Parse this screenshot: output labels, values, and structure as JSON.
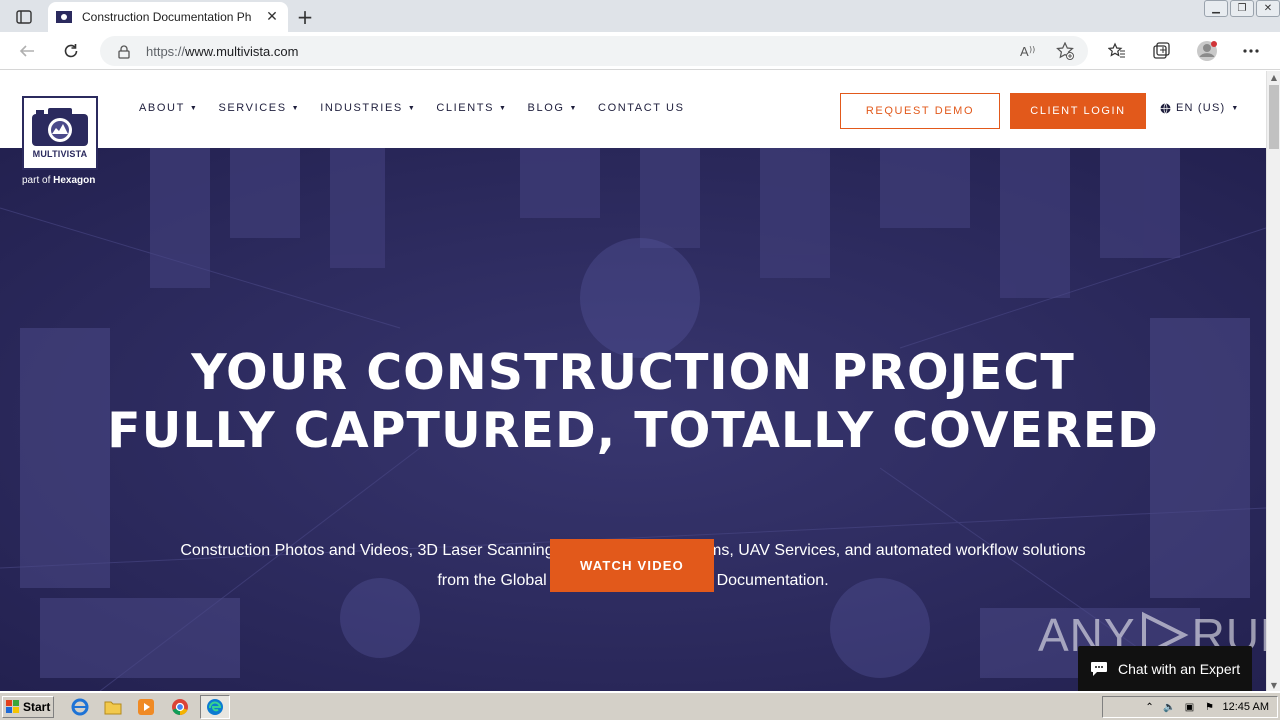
{
  "browser": {
    "tab_title": "Construction Documentation Ph",
    "url_prefix": "https://",
    "url_host": "www.multivista.com"
  },
  "site": {
    "logo_text": "MULTIVISTA",
    "logo_sub_prefix": "part of",
    "logo_sub_brand": "Hexagon",
    "nav": [
      {
        "label": "ABOUT"
      },
      {
        "label": "SERVICES"
      },
      {
        "label": "INDUSTRIES"
      },
      {
        "label": "CLIENTS"
      },
      {
        "label": "BLOG"
      },
      {
        "label": "CONTACT US"
      }
    ],
    "request_demo": "REQUEST DEMO",
    "client_login": "CLIENT LOGIN",
    "language": "EN (US)"
  },
  "hero": {
    "title_line1": "YOUR CONSTRUCTION PROJECT",
    "title_line2": "FULLY CAPTURED, TOTALLY COVERED",
    "subtitle_line1": "Construction Photos and Videos, 3D Laser Scanning, Scan to BIM, Webcams, UAV Services, and automated workflow solutions",
    "subtitle_line2": "from the Global Leader in Construction Documentation.",
    "cta": "WATCH VIDEO"
  },
  "chat": {
    "label": "Chat with an Expert"
  },
  "watermark": {
    "left": "ANY",
    "right": "RUN"
  },
  "taskbar": {
    "start": "Start",
    "clock": "12:45 AM"
  },
  "colors": {
    "brand_navy": "#2b2a5e",
    "accent_orange": "#e2591b",
    "hero_overlay": "#2c2a63"
  }
}
